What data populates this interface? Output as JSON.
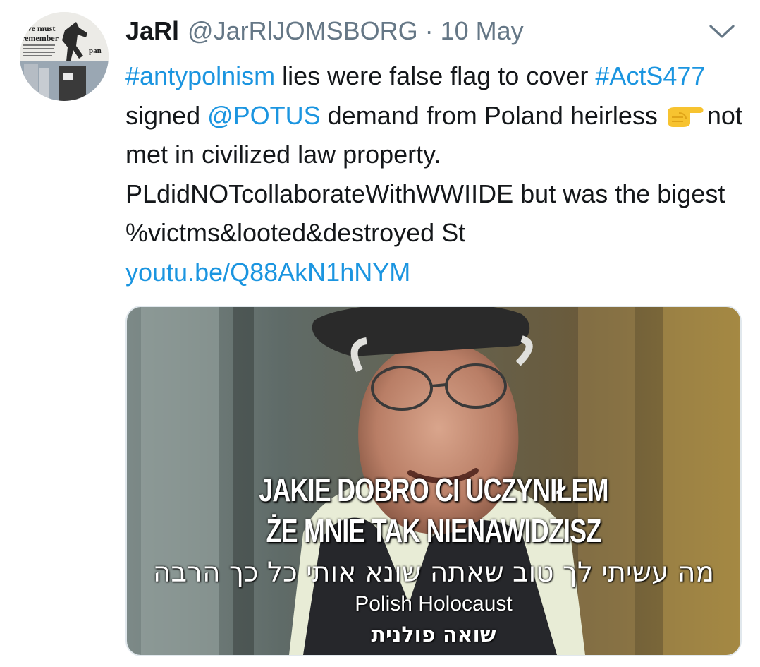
{
  "author": {
    "name": "JaRl",
    "handle": "@JarRlJOMSBORG",
    "separator": "·",
    "date": "10 May",
    "avatar_icon": "memorial-statue-avatar",
    "avatar_text": [
      "we must",
      "remember",
      "pan"
    ]
  },
  "tweet": {
    "hashtag1": "#antypolnism",
    "t1": " lies were false flag to cover ",
    "hashtag2": "#ActS477",
    "t2": " signed ",
    "mention": "@POTUS",
    "t3": " demand from Poland heirless ",
    "emoji": "backhand-index-pointing-right",
    "t4": "not met in civilized law property. PLdidNOTcollaborateWithWWIIDE but was the bigest %victms&looted&destroyed St ",
    "link": "youtu.be/Q88AkN1hNYM"
  },
  "media": {
    "subtitle_pl_line1": "JAKIE DOBRO CI UCZYNIŁEM",
    "subtitle_pl_line2": "ŻE MNIE TAK NIENAWIDZISZ",
    "subtitle_he": "מה עשיתי לך טוב שאתה שונא אותי כל כך הרבה",
    "caption_en": "Polish Holocaust",
    "caption_he": "שואה פולנית"
  },
  "colors": {
    "link": "#1b95e0",
    "secondary": "#657786",
    "text": "#14171a"
  },
  "icons": {
    "menu": "chevron-down-icon"
  }
}
